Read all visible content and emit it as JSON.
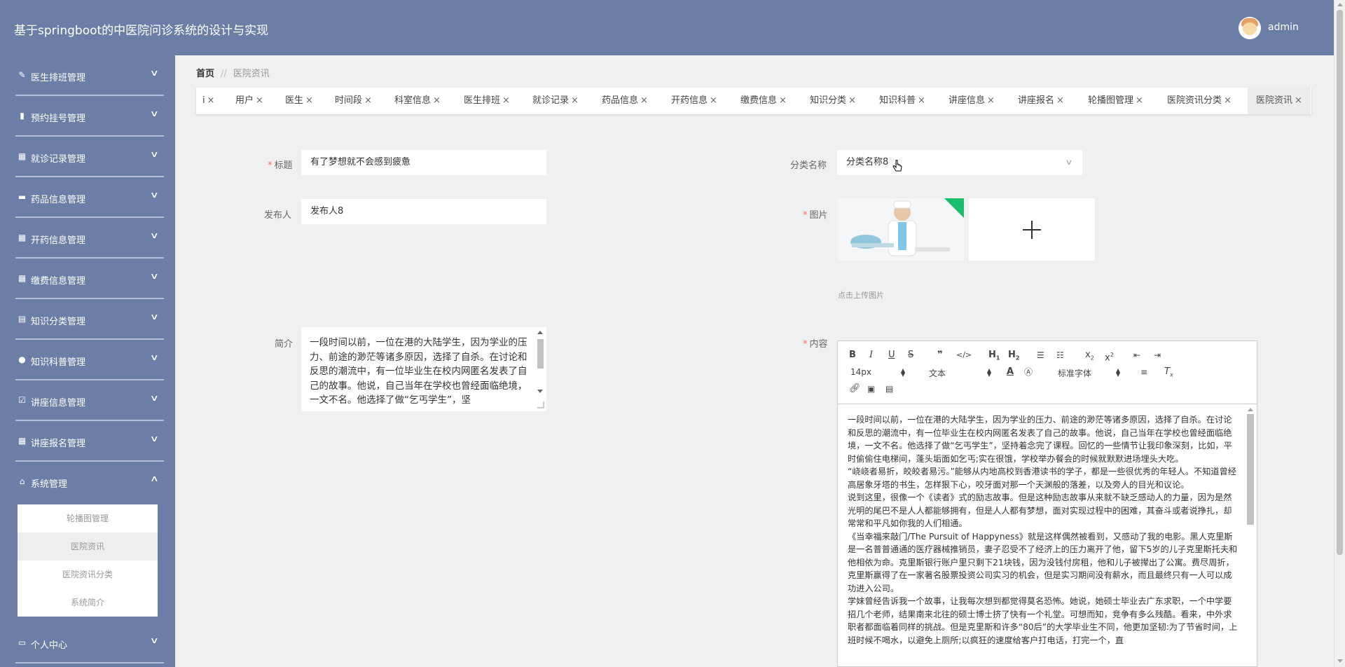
{
  "header": {
    "title": "基于springboot的中医院问诊系统的设计与实现",
    "username": "admin"
  },
  "sidebar": {
    "items": [
      {
        "label": "医生排班管理",
        "icon": "edit-icon"
      },
      {
        "label": "预约挂号管理",
        "icon": "bar-chart-icon"
      },
      {
        "label": "就诊记录管理",
        "icon": "grid-icon"
      },
      {
        "label": "药品信息管理",
        "icon": "pill-icon"
      },
      {
        "label": "开药信息管理",
        "icon": "grid-icon"
      },
      {
        "label": "缴费信息管理",
        "icon": "grid-icon"
      },
      {
        "label": "知识分类管理",
        "icon": "table-icon"
      },
      {
        "label": "知识科普管理",
        "icon": "user-icon"
      },
      {
        "label": "讲座信息管理",
        "icon": "calendar-check-icon"
      },
      {
        "label": "讲座报名管理",
        "icon": "grid-icon"
      },
      {
        "label": "系统管理",
        "icon": "home-icon"
      },
      {
        "label": "个人中心",
        "icon": "card-icon"
      }
    ],
    "submenu": [
      "轮播图管理",
      "医院资讯",
      "医院资讯分类",
      "系统简介"
    ]
  },
  "breadcrumb": {
    "home": "首页",
    "separator": "//",
    "current": "医院资讯"
  },
  "tabs": [
    "i",
    "用户",
    "医生",
    "时间段",
    "科室信息",
    "医生排班",
    "就诊记录",
    "药品信息",
    "开药信息",
    "缴费信息",
    "知识分类",
    "知识科普",
    "讲座信息",
    "讲座报名",
    "轮播图管理",
    "医院资讯分类",
    "医院资讯"
  ],
  "tab_close": "×",
  "form": {
    "title_label": "标题",
    "title_value": "有了梦想就不会感到疲惫",
    "category_label": "分类名称",
    "category_value": "分类名称8",
    "publisher_label": "发布人",
    "publisher_value": "发布人8",
    "image_label": "图片",
    "upload_tip": "点击上传图片",
    "summary_label": "简介",
    "summary_value": "一段时间以前，一位在港的大陆学生，因为学业的压力、前途的渺茫等诸多原因，选择了自杀。在讨论和反思的潮流中，有一位毕业生在校内网匿名发表了自己的故事。他说，自己当年在学校也曾经面临绝境，一文不名。他选择了做“乞丐学生”，坚",
    "content_label": "内容",
    "required_mark": "*"
  },
  "editor": {
    "font_size": "14px",
    "block_type": "文本",
    "font_family": "标准字体",
    "paragraphs": [
      "一段时间以前，一位在港的大陆学生，因为学业的压力、前途的渺茫等诸多原因，选择了自杀。在讨论和反思的潮流中，有一位毕业生在校内网匿名发表了自己的故事。他说，自己当年在学校也曾经面临绝境，一文不名。他选择了做“乞丐学生”，坚持着念完了课程。回忆的一些情节让我印象深刻，比如，平时偷偷住电梯间，蓬头垢面如乞丐;实在很饿，学校举办餐会的时候就默默进场埋头大吃。",
      "“峣峣者易折，皎皎者易污。”能够从内地高校到香港读书的学子，都是一些很优秀的年轻人。不知道曾经高居象牙塔的书生，怎样狠下心，咬牙面对那一个天渊般的落差，以及旁人的目光和议论。",
      "说到这里，很像一个《读者》式的励志故事。但是这种励志故事从来就不缺乏感动人的力量，因为是然光明的尾巴不是人人都能够拥有，但是人人都有梦想，面对实现过程中的困难，其奋斗或者说挣扎，却常常和平凡如你我的人们相通。",
      "《当幸福来敲门/The Pursuit of Happyness》就是这样偶然被看到，又感动了我的电影。黑人克里斯是一名普普通通的医疗器械推销员，妻子忍受不了经济上的压力离开了他，留下5岁的儿子克里斯托夫和他相依为命。克里斯银行账户里只剩下21块钱，因为没钱付房租，他和儿子被撵出了公寓。费尽周折，克里斯赢得了在一家著名股票投资公司实习的机会，但是实习期间没有薪水，而且最终只有一人可以成功进入公司。",
      "学妹曾经告诉我一个故事，让我每次想到都觉得莫名恐怖。她说，她硕士毕业去广东求职，一个中学要招几个老师，结果南来北往的硕士博士挤了快有一个礼堂。可想而知，竞争有多么残酷。看来，中外求职者都面临着同样的挑战。但是克里斯和许多“80后”的大学毕业生不同，他更加坚韧:为了节省时间，上班时候不喝水，以避免上厕所;以疯狂的速度给客户打电话，打完一个，直"
    ]
  }
}
